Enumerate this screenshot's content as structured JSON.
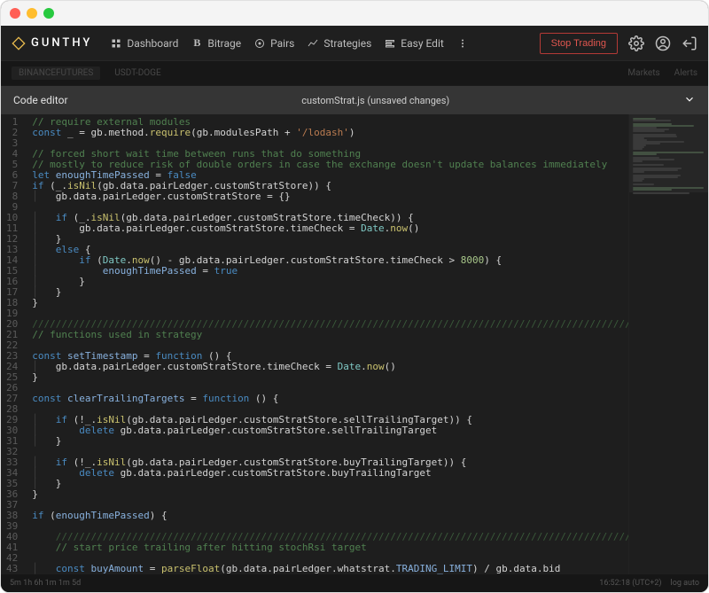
{
  "brand": "GUNTHY",
  "nav": {
    "dashboard": "Dashboard",
    "bitrage": "Bitrage",
    "pairs": "Pairs",
    "strategies": "Strategies",
    "easy_edit": "Easy Edit"
  },
  "actions": {
    "stop_trading": "Stop Trading"
  },
  "subbar": {
    "exchange": "BINANCEFUTURES",
    "pair": "USDT-DOGE",
    "markets": "Markets",
    "alerts": "Alerts"
  },
  "editor": {
    "title": "Code editor",
    "file": "customStrat.js (unsaved changes)"
  },
  "code": {
    "line_start": 1,
    "lines": [
      {
        "t": "comment",
        "s": "// require external modules"
      },
      {
        "t": "code",
        "s": "const _ = gb.method.require(gb.modulesPath + '/lodash')"
      },
      {
        "t": "blank",
        "s": ""
      },
      {
        "t": "comment",
        "s": "// forced short wait time between runs that do something"
      },
      {
        "t": "comment",
        "s": "// mostly to reduce risk of double orders in case the exchange doesn't update balances immediately"
      },
      {
        "t": "code",
        "s": "let enoughTimePassed = false"
      },
      {
        "t": "code",
        "s": "if (_.isNil(gb.data.pairLedger.customStratStore)) {"
      },
      {
        "t": "code",
        "s": "    gb.data.pairLedger.customStratStore = {}"
      },
      {
        "t": "blank",
        "s": ""
      },
      {
        "t": "code",
        "s": "    if (_.isNil(gb.data.pairLedger.customStratStore.timeCheck)) {"
      },
      {
        "t": "code",
        "s": "        gb.data.pairLedger.customStratStore.timeCheck = Date.now()"
      },
      {
        "t": "code",
        "s": "    }"
      },
      {
        "t": "code",
        "s": "    else {"
      },
      {
        "t": "code",
        "s": "        if (Date.now() - gb.data.pairLedger.customStratStore.timeCheck > 8000) {"
      },
      {
        "t": "code",
        "s": "            enoughTimePassed = true"
      },
      {
        "t": "code",
        "s": "        }"
      },
      {
        "t": "code",
        "s": "    }"
      },
      {
        "t": "code",
        "s": "}"
      },
      {
        "t": "blank",
        "s": ""
      },
      {
        "t": "divider",
        "s": "////////////////////////////////////////////////////////////////////////////////////////////////////////////////////"
      },
      {
        "t": "comment",
        "s": "// functions used in strategy"
      },
      {
        "t": "blank",
        "s": ""
      },
      {
        "t": "code",
        "s": "const setTimestamp = function () {"
      },
      {
        "t": "code",
        "s": "    gb.data.pairLedger.customStratStore.timeCheck = Date.now()"
      },
      {
        "t": "code",
        "s": "}"
      },
      {
        "t": "blank",
        "s": ""
      },
      {
        "t": "code",
        "s": "const clearTrailingTargets = function () {"
      },
      {
        "t": "blank",
        "s": ""
      },
      {
        "t": "code",
        "s": "    if (!_.isNil(gb.data.pairLedger.customStratStore.sellTrailingTarget)) {"
      },
      {
        "t": "code",
        "s": "        delete gb.data.pairLedger.customStratStore.sellTrailingTarget"
      },
      {
        "t": "code",
        "s": "    }"
      },
      {
        "t": "blank",
        "s": ""
      },
      {
        "t": "code",
        "s": "    if (!_.isNil(gb.data.pairLedger.customStratStore.buyTrailingTarget)) {"
      },
      {
        "t": "code",
        "s": "        delete gb.data.pairLedger.customStratStore.buyTrailingTarget"
      },
      {
        "t": "code",
        "s": "    }"
      },
      {
        "t": "code",
        "s": "}"
      },
      {
        "t": "blank",
        "s": ""
      },
      {
        "t": "code",
        "s": "if (enoughTimePassed) {"
      },
      {
        "t": "blank",
        "s": ""
      },
      {
        "t": "divider",
        "s": "    ////////////////////////////////////////////////////////////////////////////////////////////////////////////////"
      },
      {
        "t": "comment",
        "s": "    // start price trailing after hitting stochRsi target"
      },
      {
        "t": "blank",
        "s": ""
      },
      {
        "t": "code",
        "s": "    const buyAmount = parseFloat(gb.data.pairLedger.whatstrat.TRADING_LIMIT) / gb.data.bid"
      },
      {
        "t": "blank",
        "s": ""
      }
    ]
  },
  "status": {
    "tf": "5m  1h  6h  1m  1m  5d",
    "time": "16:52:18 (UTC+2)",
    "mode": "log  auto"
  }
}
